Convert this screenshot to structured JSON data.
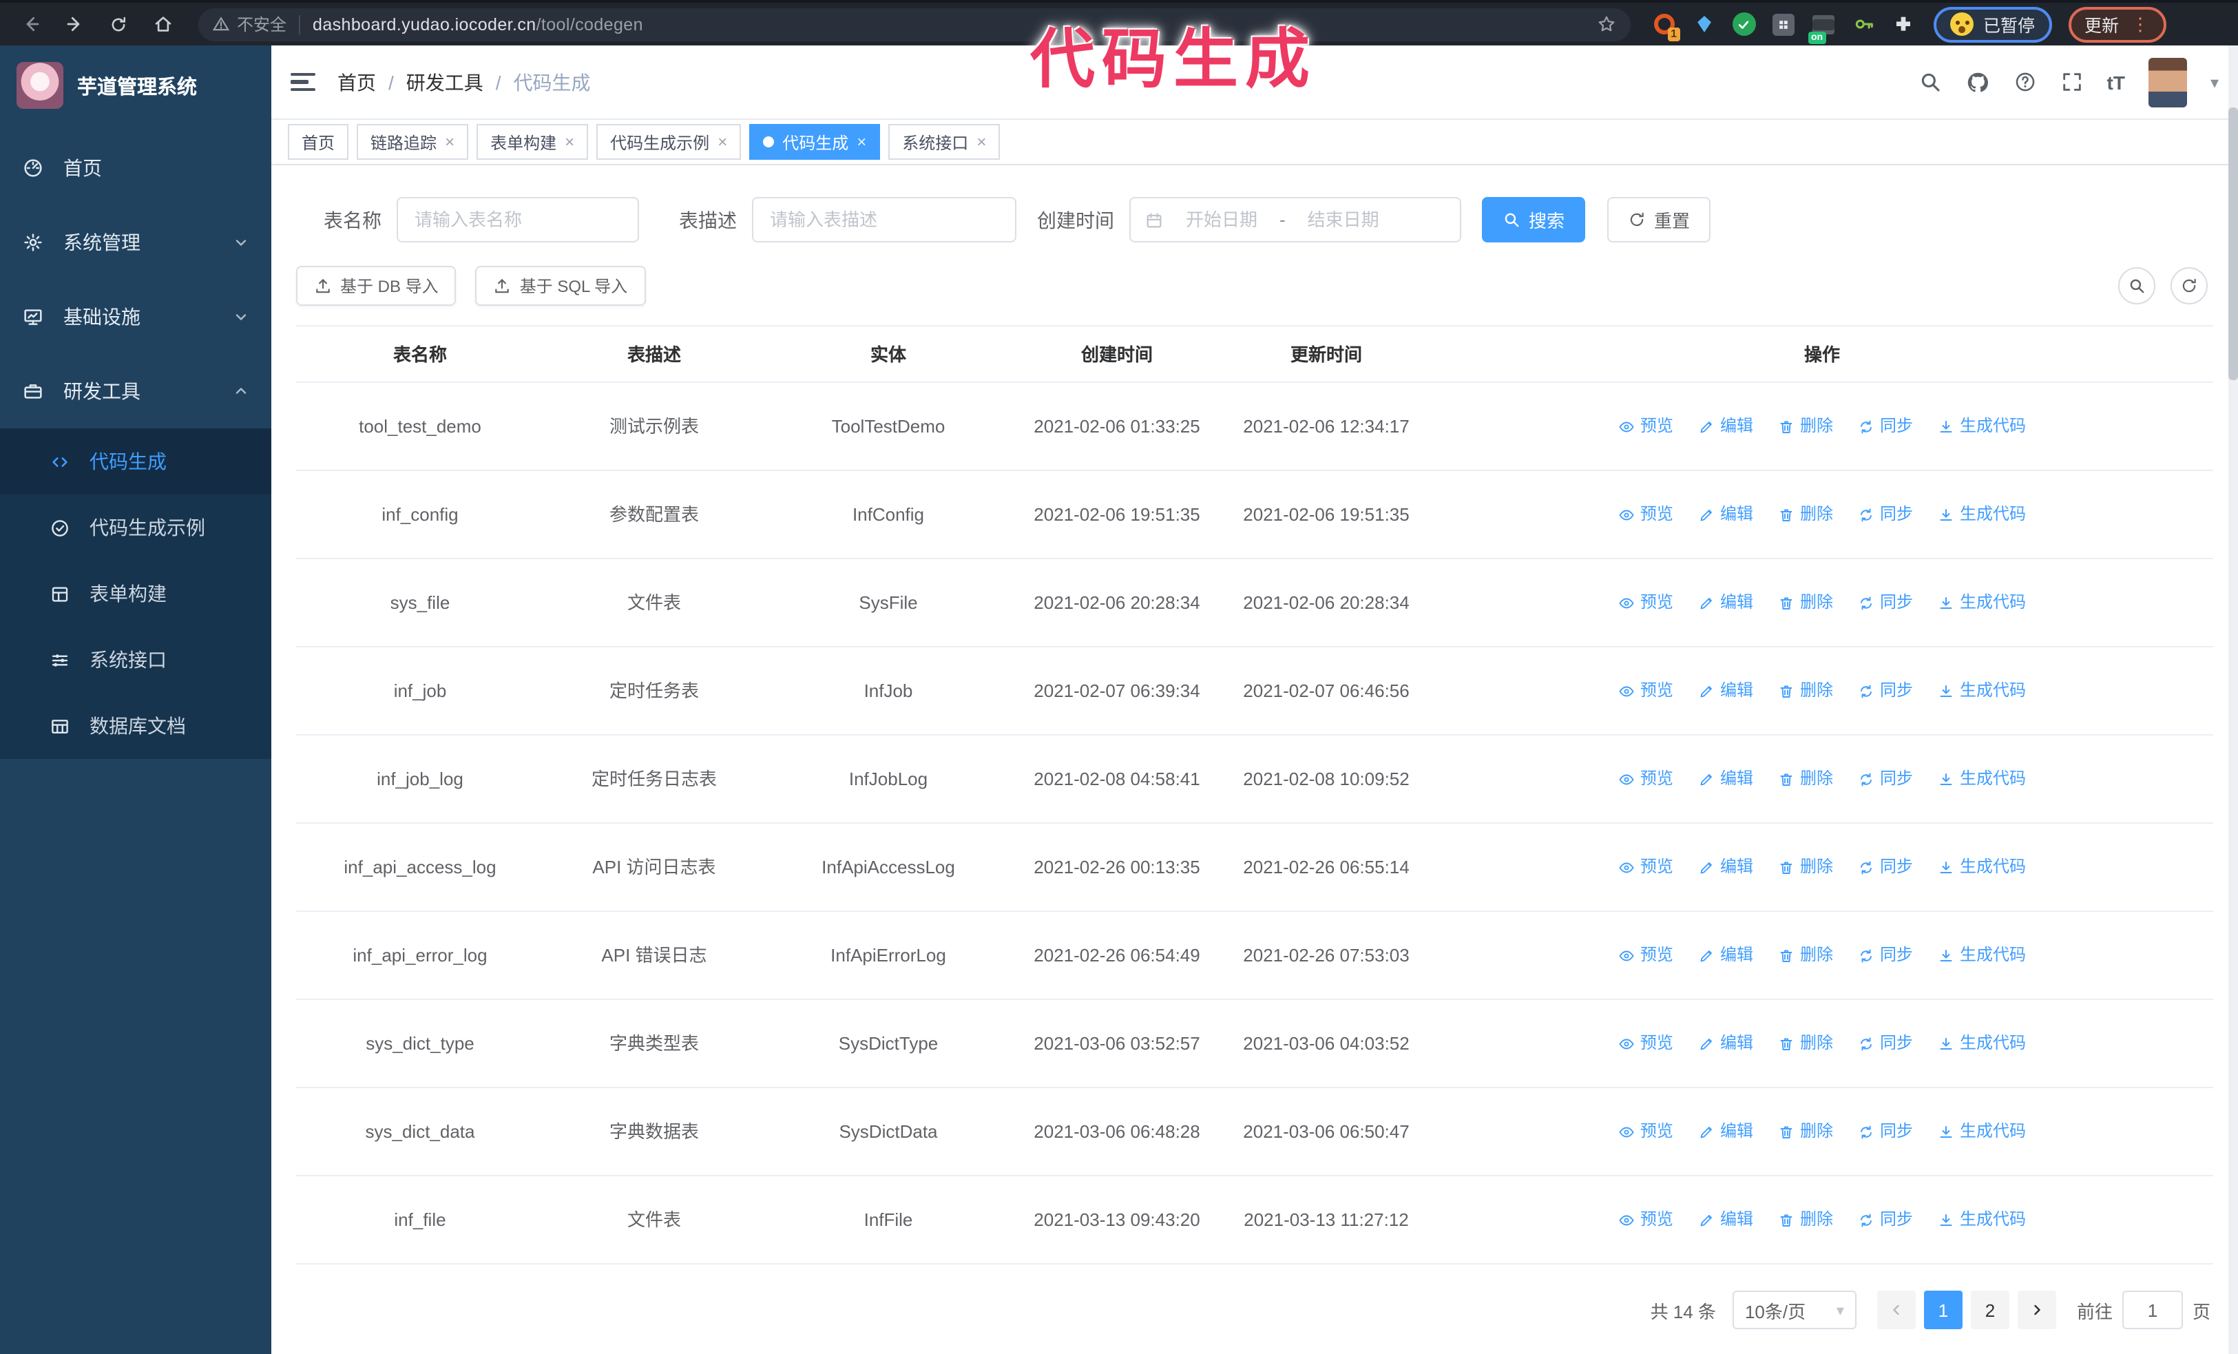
{
  "browser": {
    "security_label": "不安全",
    "url_domain": "dashboard.yudao.iocoder.cn",
    "url_path": "/tool/codegen",
    "ext_badge_1": "1",
    "ext_badge_on": "on",
    "profile_paused_label": "已暂停",
    "update_label": "更新"
  },
  "overlay": {
    "title": "代码生成"
  },
  "icons": {
    "close": "×",
    "caret": "▾",
    "kebab": "⋮",
    "font_size": "tT",
    "range_dash": "-"
  },
  "sidebar": {
    "app_title": "芋道管理系统",
    "items": [
      {
        "label": "首页"
      },
      {
        "label": "系统管理"
      },
      {
        "label": "基础设施"
      },
      {
        "label": "研发工具"
      }
    ],
    "sub_items": [
      {
        "label": "代码生成"
      },
      {
        "label": "代码生成示例"
      },
      {
        "label": "表单构建"
      },
      {
        "label": "系统接口"
      },
      {
        "label": "数据库文档"
      }
    ]
  },
  "breadcrumb": {
    "items": [
      "首页",
      "研发工具",
      "代码生成"
    ],
    "separator": "/"
  },
  "tabs": [
    {
      "label": "首页"
    },
    {
      "label": "链路追踪"
    },
    {
      "label": "表单构建"
    },
    {
      "label": "代码生成示例"
    },
    {
      "label": "代码生成"
    },
    {
      "label": "系统接口"
    }
  ],
  "filters": {
    "table_name_label": "表名称",
    "table_name_placeholder": "请输入表名称",
    "table_desc_label": "表描述",
    "table_desc_placeholder": "请输入表描述",
    "create_time_label": "创建时间",
    "start_date_placeholder": "开始日期",
    "end_date_placeholder": "结束日期",
    "search_label": "搜索",
    "reset_label": "重置"
  },
  "toolbar": {
    "import_db_label": "基于 DB 导入",
    "import_sql_label": "基于 SQL 导入"
  },
  "table": {
    "columns": [
      "表名称",
      "表描述",
      "实体",
      "创建时间",
      "更新时间",
      "操作"
    ],
    "actions": [
      "预览",
      "编辑",
      "删除",
      "同步",
      "生成代码"
    ],
    "rows": [
      {
        "name": "tool_test_demo",
        "desc": "测试示例表",
        "entity": "ToolTestDemo",
        "created": "2021-02-06 01:33:25",
        "updated": "2021-02-06 12:34:17"
      },
      {
        "name": "inf_config",
        "desc": "参数配置表",
        "entity": "InfConfig",
        "created": "2021-02-06 19:51:35",
        "updated": "2021-02-06 19:51:35"
      },
      {
        "name": "sys_file",
        "desc": "文件表",
        "entity": "SysFile",
        "created": "2021-02-06 20:28:34",
        "updated": "2021-02-06 20:28:34"
      },
      {
        "name": "inf_job",
        "desc": "定时任务表",
        "entity": "InfJob",
        "created": "2021-02-07 06:39:34",
        "updated": "2021-02-07 06:46:56"
      },
      {
        "name": "inf_job_log",
        "desc": "定时任务日志表",
        "entity": "InfJobLog",
        "created": "2021-02-08 04:58:41",
        "updated": "2021-02-08 10:09:52"
      },
      {
        "name": "inf_api_access_log",
        "desc": "API 访问日志表",
        "entity": "InfApiAccessLog",
        "created": "2021-02-26 00:13:35",
        "updated": "2021-02-26 06:55:14"
      },
      {
        "name": "inf_api_error_log",
        "desc": "API 错误日志",
        "entity": "InfApiErrorLog",
        "created": "2021-02-26 06:54:49",
        "updated": "2021-02-26 07:53:03"
      },
      {
        "name": "sys_dict_type",
        "desc": "字典类型表",
        "entity": "SysDictType",
        "created": "2021-03-06 03:52:57",
        "updated": "2021-03-06 04:03:52"
      },
      {
        "name": "sys_dict_data",
        "desc": "字典数据表",
        "entity": "SysDictData",
        "created": "2021-03-06 06:48:28",
        "updated": "2021-03-06 06:50:47"
      },
      {
        "name": "inf_file",
        "desc": "文件表",
        "entity": "InfFile",
        "created": "2021-03-13 09:43:20",
        "updated": "2021-03-13 11:27:12"
      }
    ]
  },
  "pagination": {
    "total_text": "共 14 条",
    "page_size_text": "10条/页",
    "pages": [
      "1",
      "2"
    ],
    "active_page": "1",
    "goto_label": "前往",
    "goto_value": "1",
    "page_suffix": "页"
  },
  "colors": {
    "accent": "#409eff",
    "sidebar_bg": "#20425f",
    "submenu_bg": "#17344e",
    "annotation_pink": "#ed3a62",
    "chrome_bg": "#20252d"
  }
}
